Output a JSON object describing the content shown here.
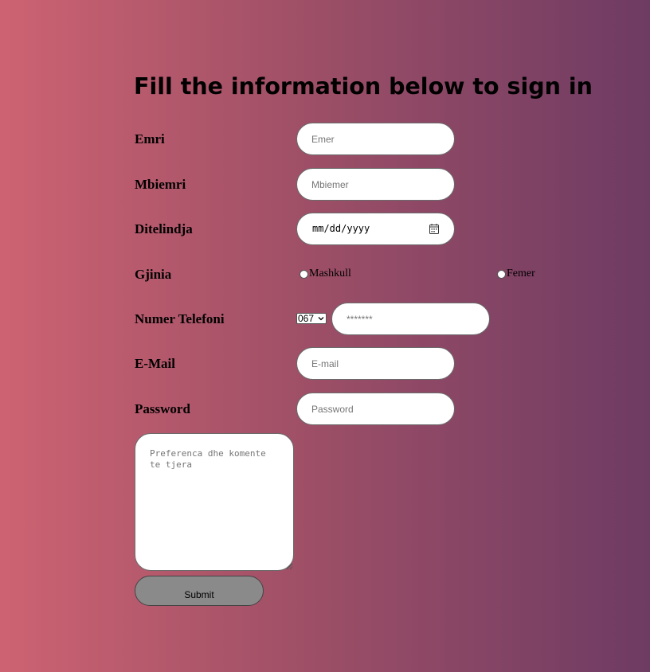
{
  "title": "Fill the information below to sign in",
  "fields": {
    "emri": {
      "label": "Emri",
      "placeholder": "Emer"
    },
    "mbiemri": {
      "label": "Mbiemri",
      "placeholder": "Mbiemer"
    },
    "ditelindja": {
      "label": "Ditelindja",
      "value": "mm/dd/yyyy",
      "icon": "calendar-icon"
    },
    "gjinia": {
      "label": "Gjinia",
      "options": [
        "Mashkull",
        "Femer"
      ]
    },
    "telefoni": {
      "label": "Numer Telefoni",
      "prefix": "067",
      "placeholder": "*******"
    },
    "email": {
      "label": "E-Mail",
      "placeholder": "E-mail"
    },
    "password": {
      "label": "Password",
      "placeholder": "Password"
    }
  },
  "comments": {
    "placeholder": "Preferenca dhe komente te tjera"
  },
  "submit": {
    "label": "Submit"
  },
  "colors": {
    "gradient_start": "#cd6372",
    "gradient_end": "#6e3b63",
    "button": "#8a8a8a"
  }
}
